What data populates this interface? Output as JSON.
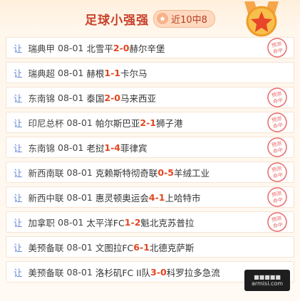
{
  "header": {
    "title": "足球小强强",
    "badge_text": "近10中8"
  },
  "rows": [
    {
      "tag": "让",
      "league": "瑞典甲",
      "date": "08-01",
      "home": "北雪平",
      "home_score": "2",
      "away_score": "0",
      "away": "赫尔辛堡",
      "stamp": "预测命中"
    },
    {
      "tag": "让",
      "league": "瑞典超",
      "date": "08-01",
      "home": "赫根",
      "home_score": "1",
      "away_score": "1",
      "away": "卡尔马",
      "stamp": ""
    },
    {
      "tag": "让",
      "league": "东南锦",
      "date": "08-01",
      "home": "泰国",
      "home_score": "2",
      "away_score": "0",
      "away": "马来西亚",
      "stamp": "预测命中"
    },
    {
      "tag": "让",
      "league": "印尼总杯",
      "date": "08-01",
      "home": "帕尔斯巴亚",
      "home_score": "2",
      "away_score": "1",
      "away": "狮子港",
      "stamp": "预测命中"
    },
    {
      "tag": "让",
      "league": "东南锦",
      "date": "08-01",
      "home": "老挝",
      "home_score": "1",
      "away_score": "4",
      "away": "菲律宾",
      "stamp": "预测命中"
    },
    {
      "tag": "让",
      "league": "新西南联",
      "date": "08-01",
      "home": "克赖斯特彻奇联",
      "home_score": "0",
      "away_score": "5",
      "away": "羊绒工业",
      "stamp": "预测命中"
    },
    {
      "tag": "让",
      "league": "新西中联",
      "date": "08-01",
      "home": "惠灵顿奥运会",
      "home_score": "4",
      "away_score": "1",
      "away": "上哈特市",
      "stamp": "预测命中"
    },
    {
      "tag": "让",
      "league": "加拿职",
      "date": "08-01",
      "home": "太平洋FC",
      "home_score": "1",
      "away_score": "2",
      "away": "魁北克苏普拉",
      "stamp": "预测命中"
    },
    {
      "tag": "让",
      "league": "美预备联",
      "date": "08-01",
      "home": "文图拉FC",
      "home_score": "6",
      "away_score": "1",
      "away": "北德克萨斯",
      "stamp": ""
    },
    {
      "tag": "让",
      "league": "美预备联",
      "date": "08-01",
      "home": "洛杉矶FC II队",
      "home_score": "3",
      "away_score": "0",
      "away": "科罗拉多急流",
      "stamp": ""
    }
  ],
  "watermark": {
    "line1": "■■■■■",
    "line2": "armisi.com"
  },
  "colors": {
    "accent": "#e2461f",
    "tag": "#5a7fd6",
    "stamp": "#e86a6a"
  }
}
